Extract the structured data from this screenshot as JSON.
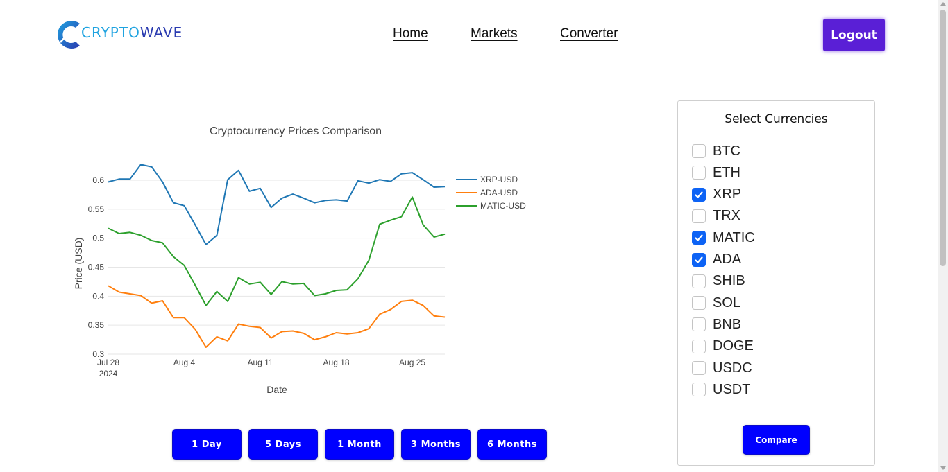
{
  "header": {
    "logo_text_a": "CRYPTO",
    "logo_text_b": "WAVE",
    "nav": [
      {
        "label": "Home"
      },
      {
        "label": "Markets"
      },
      {
        "label": "Converter"
      }
    ],
    "logout_label": "Logout"
  },
  "colors": {
    "accent": "#0000ff",
    "logout": "#5a1fd6",
    "checkbox": "#0d63f5",
    "xrp": "#1f77b4",
    "ada": "#ff7f0e",
    "matic": "#2ca02c"
  },
  "chart_data": {
    "type": "line",
    "title": "Cryptocurrency Prices Comparison",
    "xlabel": "Date",
    "ylabel": "Price (USD)",
    "x_ticks": [
      "Jul 28",
      "Aug 4",
      "Aug 11",
      "Aug 18",
      "Aug 25"
    ],
    "x_tick_sub": "2024",
    "x_start": "2024-07-28",
    "x_end": "2024-08-28",
    "y_ticks": [
      "0.3",
      "0.35",
      "0.4",
      "0.45",
      "0.5",
      "0.55",
      "0.6"
    ],
    "ylim": [
      0.3,
      0.6
    ],
    "grid": true,
    "legend_position": "top-right",
    "x": [
      "2024-07-28",
      "2024-07-29",
      "2024-07-30",
      "2024-07-31",
      "2024-08-01",
      "2024-08-02",
      "2024-08-03",
      "2024-08-04",
      "2024-08-05",
      "2024-08-06",
      "2024-08-07",
      "2024-08-08",
      "2024-08-09",
      "2024-08-10",
      "2024-08-11",
      "2024-08-12",
      "2024-08-13",
      "2024-08-14",
      "2024-08-15",
      "2024-08-16",
      "2024-08-17",
      "2024-08-18",
      "2024-08-19",
      "2024-08-20",
      "2024-08-21",
      "2024-08-22",
      "2024-08-23",
      "2024-08-24",
      "2024-08-25",
      "2024-08-26",
      "2024-08-27",
      "2024-08-28"
    ],
    "series": [
      {
        "name": "XRP-USD",
        "values": [
          0.597,
          0.602,
          0.602,
          0.627,
          0.623,
          0.597,
          0.561,
          0.556,
          0.523,
          0.489,
          0.505,
          0.601,
          0.617,
          0.581,
          0.586,
          0.553,
          0.569,
          0.576,
          0.569,
          0.561,
          0.565,
          0.566,
          0.564,
          0.599,
          0.595,
          0.601,
          0.598,
          0.611,
          0.613,
          0.601,
          0.588,
          0.589
        ]
      },
      {
        "name": "ADA-USD",
        "values": [
          0.418,
          0.407,
          0.404,
          0.401,
          0.388,
          0.392,
          0.363,
          0.363,
          0.343,
          0.312,
          0.33,
          0.323,
          0.352,
          0.348,
          0.346,
          0.328,
          0.339,
          0.34,
          0.336,
          0.325,
          0.33,
          0.337,
          0.335,
          0.337,
          0.344,
          0.369,
          0.377,
          0.391,
          0.393,
          0.384,
          0.366,
          0.364
        ]
      },
      {
        "name": "MATIC-USD",
        "values": [
          0.517,
          0.508,
          0.51,
          0.505,
          0.496,
          0.492,
          0.468,
          0.453,
          0.419,
          0.384,
          0.408,
          0.391,
          0.432,
          0.421,
          0.424,
          0.403,
          0.425,
          0.421,
          0.422,
          0.401,
          0.404,
          0.41,
          0.411,
          0.43,
          0.462,
          0.524,
          0.531,
          0.537,
          0.571,
          0.523,
          0.502,
          0.507
        ]
      }
    ]
  },
  "range_buttons": [
    {
      "label": "1 Day"
    },
    {
      "label": "5 Days"
    },
    {
      "label": "1 Month"
    },
    {
      "label": "3 Months"
    },
    {
      "label": "6 Months"
    }
  ],
  "currency_panel": {
    "title": "Select Currencies",
    "items": [
      {
        "label": "BTC",
        "checked": false
      },
      {
        "label": "ETH",
        "checked": false
      },
      {
        "label": "XRP",
        "checked": true
      },
      {
        "label": "TRX",
        "checked": false
      },
      {
        "label": "MATIC",
        "checked": true
      },
      {
        "label": "ADA",
        "checked": true
      },
      {
        "label": "SHIB",
        "checked": false
      },
      {
        "label": "SOL",
        "checked": false
      },
      {
        "label": "BNB",
        "checked": false
      },
      {
        "label": "DOGE",
        "checked": false
      },
      {
        "label": "USDC",
        "checked": false
      },
      {
        "label": "USDT",
        "checked": false
      }
    ],
    "compare_label": "Compare"
  }
}
